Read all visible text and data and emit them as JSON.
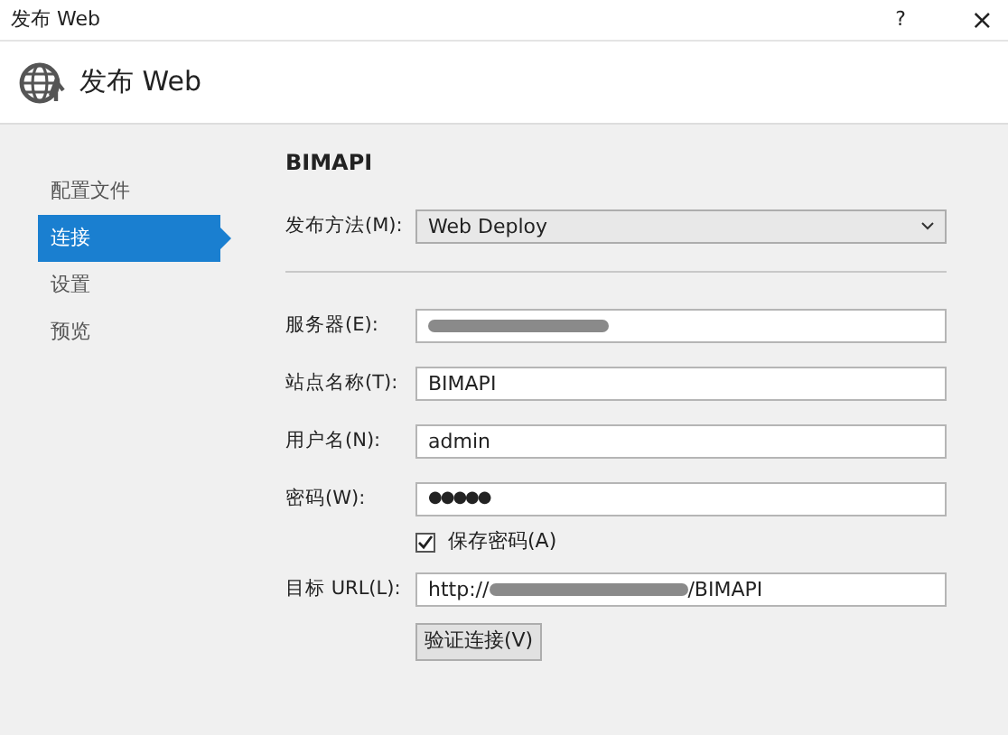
{
  "window": {
    "title": "发布 Web",
    "help": "?",
    "close": "×"
  },
  "header": {
    "title": "发布 Web"
  },
  "sidebar": {
    "items": [
      {
        "label": "配置文件",
        "selected": false
      },
      {
        "label": "连接",
        "selected": true
      },
      {
        "label": "设置",
        "selected": false
      },
      {
        "label": "预览",
        "selected": false
      }
    ]
  },
  "profile_name": "BIMAPI",
  "publish_method": {
    "label": "发布方法(M):",
    "value": "Web Deploy"
  },
  "fields": [
    {
      "label": "服务器(E):",
      "kind": "redacted"
    },
    {
      "label": "站点名称(T):",
      "kind": "text",
      "value": "BIMAPI"
    },
    {
      "label": "用户名(N):",
      "kind": "text",
      "value": "admin"
    },
    {
      "label": "密码(W):",
      "kind": "password",
      "value": "●●●●●"
    }
  ],
  "save_password": {
    "label": "保存密码(A)",
    "checked": true
  },
  "target_url": {
    "label": "目标 URL(L):",
    "value_start": "http://",
    "value_end": "/BIMAPI"
  },
  "validate_button": "验证连接(V)"
}
